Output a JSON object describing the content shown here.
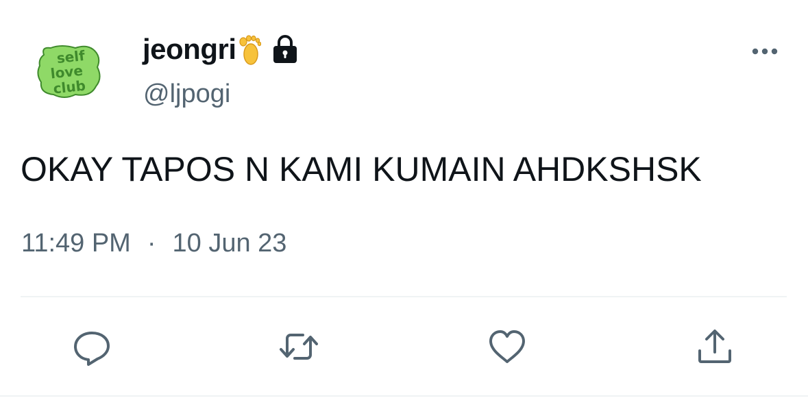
{
  "author": {
    "display_name": "jeongri",
    "handle": "@ljpogi",
    "avatar_text_lines": [
      "self",
      "love",
      "club"
    ],
    "name_emoji": "foot-emoji",
    "protected_icon": "lock-icon"
  },
  "tweet": {
    "text": "OKAY TAPOS N KAMI KUMAIN AHDKSHSK",
    "time": "11:49 PM",
    "separator": "·",
    "date": "10 Jun 23"
  },
  "actions": [
    {
      "name": "reply",
      "icon": "reply-icon"
    },
    {
      "name": "retweet",
      "icon": "retweet-icon"
    },
    {
      "name": "like",
      "icon": "heart-icon"
    },
    {
      "name": "share",
      "icon": "share-icon"
    }
  ],
  "colors": {
    "text_primary": "#0f1419",
    "text_secondary": "#536471",
    "divider": "#eff3f4",
    "avatar_green": "#8fd967",
    "avatar_dark_green": "#3f8a2c",
    "emoji_yellow": "#f7c23b"
  }
}
